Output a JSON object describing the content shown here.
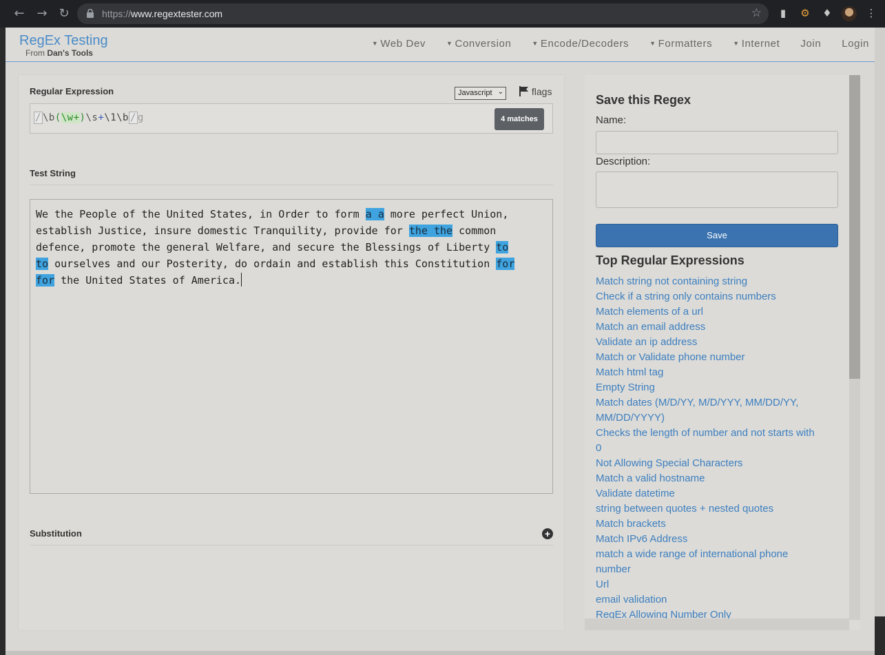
{
  "browser": {
    "url_prefix": "https://",
    "url_host": "www.regextester.com"
  },
  "site": {
    "title": "RegEx Testing",
    "subtitle_prefix": "From",
    "subtitle_brand": "Dan's Tools"
  },
  "nav": [
    {
      "label": "Web Dev",
      "dropdown": true
    },
    {
      "label": "Conversion",
      "dropdown": true
    },
    {
      "label": "Encode/Decoders",
      "dropdown": true
    },
    {
      "label": "Formatters",
      "dropdown": true
    },
    {
      "label": "Internet",
      "dropdown": true
    },
    {
      "label": "Join",
      "dropdown": false
    },
    {
      "label": "Login",
      "dropdown": false
    }
  ],
  "regex": {
    "label": "Regular Expression",
    "flavor": "Javascript",
    "flags_label": "flags",
    "open_delim": "/",
    "part_b1": "\\b",
    "group_open": "(",
    "group_inner": "\\w+",
    "group_close": ")",
    "part_s": "\\s",
    "part_plus": "+",
    "part_back": "\\1\\b",
    "close_delim": "/",
    "flag": "g",
    "match_count": "4 matches"
  },
  "test": {
    "label": "Test String",
    "segments": [
      {
        "t": "We the People of the United States, in Order to form ",
        "hl": false
      },
      {
        "t": "a a",
        "hl": true
      },
      {
        "t": " more perfect Union,\nestablish Justice, insure domestic Tranquility, provide for ",
        "hl": false
      },
      {
        "t": "the the",
        "hl": true
      },
      {
        "t": " common\ndefence, promote the general Welfare, and secure the Blessings of Liberty ",
        "hl": false
      },
      {
        "t": "to\nto",
        "hl": true
      },
      {
        "t": " ourselves and our Posterity, do ordain and establish this Constitution ",
        "hl": false
      },
      {
        "t": "for\nfor",
        "hl": true
      },
      {
        "t": " the United States of America.",
        "hl": false
      }
    ]
  },
  "substitution": {
    "label": "Substitution"
  },
  "save": {
    "title": "Save this Regex",
    "name_label": "Name:",
    "description_label": "Description:",
    "button": "Save"
  },
  "top": {
    "title": "Top Regular Expressions",
    "items": [
      "Match string not containing string",
      "Check if a string only contains numbers",
      "Match elements of a url",
      "Match an email address",
      "Validate an ip address",
      "Match or Validate phone number",
      "Match html tag",
      "Empty String",
      "Match dates (M/D/YY, M/D/YYY, MM/DD/YY, MM/DD/YYYY)",
      "Checks the length of number and not starts with 0",
      "Not Allowing Special Characters",
      "Match a valid hostname",
      "Validate datetime",
      "string between quotes + nested quotes",
      "Match brackets",
      "Match IPv6 Address",
      "match a wide range of international phone number",
      "Url",
      "email validation",
      "RegEx Allowing Number Only"
    ]
  }
}
